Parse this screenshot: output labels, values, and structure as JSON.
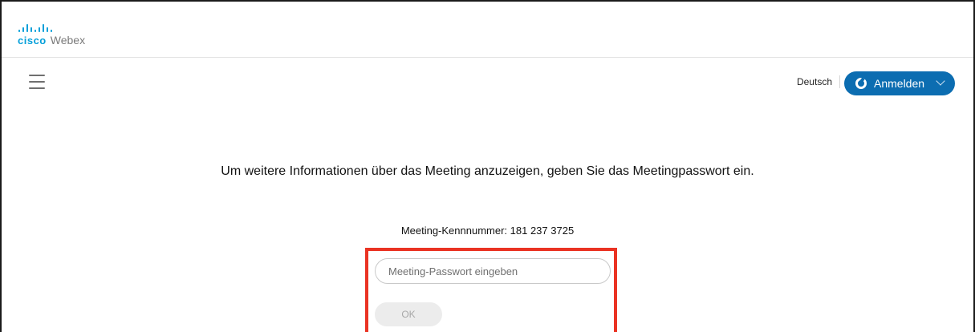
{
  "brand": {
    "logo_text": "cisco",
    "product_name": "Webex"
  },
  "header": {
    "language": "Deutsch",
    "signin_label": "Anmelden"
  },
  "main": {
    "prompt": "Um weitere Informationen über das Meeting anzuzeigen, geben Sie das Meetingpasswort ein.",
    "meeting_id": "Meeting-Kennnummer: 181 237 3725",
    "password_placeholder": "Meeting-Passwort eingeben",
    "password_value": "",
    "ok_label": "OK"
  },
  "colors": {
    "brand_blue": "#049fd9",
    "signin_button": "#0c6db1",
    "highlight_box": "#ea3323"
  },
  "icons": {
    "menu": "hamburger-icon",
    "signin": "webex-icon",
    "dropdown": "chevron-down-icon"
  }
}
